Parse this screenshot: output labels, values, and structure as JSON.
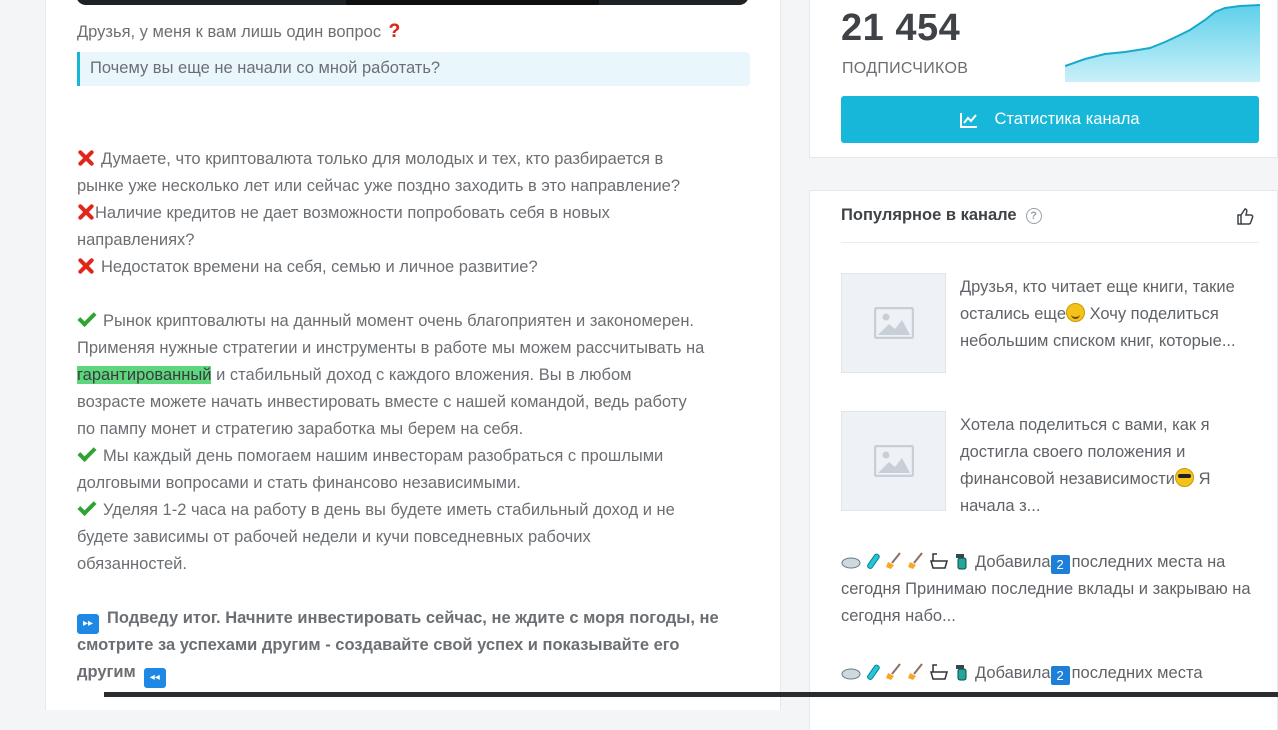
{
  "post": {
    "intro": "Друзья, у меня к вам лишь один вопрос",
    "intro_mark": "?",
    "quote": "Почему вы еще не начали со мной работать?",
    "lines": [
      {
        "icon": "cross",
        "text": "Думаете, что криптовалюта только для молодых и тех, кто разбирается в"
      },
      {
        "icon": "",
        "text": "рынке уже несколько лет или сейчас уже поздно заходить в это направление?"
      },
      {
        "icon": "cross-tight",
        "text": "Наличие кредитов не дает возможности попробовать себя в новых"
      },
      {
        "icon": "",
        "text": "направлениях?"
      },
      {
        "icon": "cross",
        "text": "Недостаток времени на себя, семью и личное развитие?"
      },
      {
        "icon": "gap",
        "text": ""
      },
      {
        "icon": "check",
        "text": "Рынок криптовалюты на данный момент очень благоприятен и закономерен."
      },
      {
        "icon": "",
        "text": "Применяя нужные стратегии и инструменты в работе мы можем рассчитывать на"
      },
      {
        "icon": "highlight",
        "highlight": "гарантированный",
        "text": " и стабильный доход с каждого вложения. Вы в любом"
      },
      {
        "icon": "",
        "text": "возрасте можете начать инвестировать вместе с нашей командой, ведь работу"
      },
      {
        "icon": "",
        "text": "по пампу монет и стратегию заработка мы берем на себя."
      },
      {
        "icon": "check",
        "text": "Мы каждый день помогаем нашим инвесторам разобраться с прошлыми"
      },
      {
        "icon": "",
        "text": "долговыми вопросами и стать финансово независимыми."
      },
      {
        "icon": "check",
        "text": "Уделяя 1-2 часа на работу в день вы будете иметь стабильный доход и не"
      },
      {
        "icon": "",
        "text": "будете зависимы от рабочей недели и кучи повседневных рабочих"
      },
      {
        "icon": "",
        "text": "обязанностей."
      },
      {
        "icon": "gap",
        "text": ""
      },
      {
        "icon": "ff",
        "bold": true,
        "text": "Подведу итог. Начните инвестировать сейчас, не ждите с моря погоды, не"
      },
      {
        "icon": "",
        "bold": true,
        "text": "смотрите за успехами другим - создавайте свой успех и показывайте его"
      },
      {
        "icon": "rw-end",
        "bold": true,
        "text": "другим"
      }
    ],
    "ff_icon": "fast-forward-icon",
    "rw_icon": "rewind-icon"
  },
  "stats": {
    "subscribers": "21 454",
    "subscribers_label": "ПОДПИСЧИКОВ",
    "button_label": "Статистика канала",
    "accent": "#16b7d9"
  },
  "popular": {
    "title": "Популярное в канале",
    "items": [
      {
        "thumb": true,
        "text": "Друзья, кто читает еще книги, такие остались еще",
        "emoji": "smile",
        "text2": " Хочу поделиться небольшим списком книг, которые..."
      },
      {
        "thumb": true,
        "text": "Хотела поделиться с вами, как я достигла своего положения и финансовой независимости",
        "emoji": "glasses",
        "text2": " Я начала з..."
      },
      {
        "thumb": false,
        "text": "Добавила",
        "text2": "последних места на сегодня Принимаю последние вклады и закрываю на сегодня набо..."
      },
      {
        "thumb": false,
        "text": "Добавила",
        "text2": "последних места"
      }
    ],
    "badge_number": "2"
  }
}
